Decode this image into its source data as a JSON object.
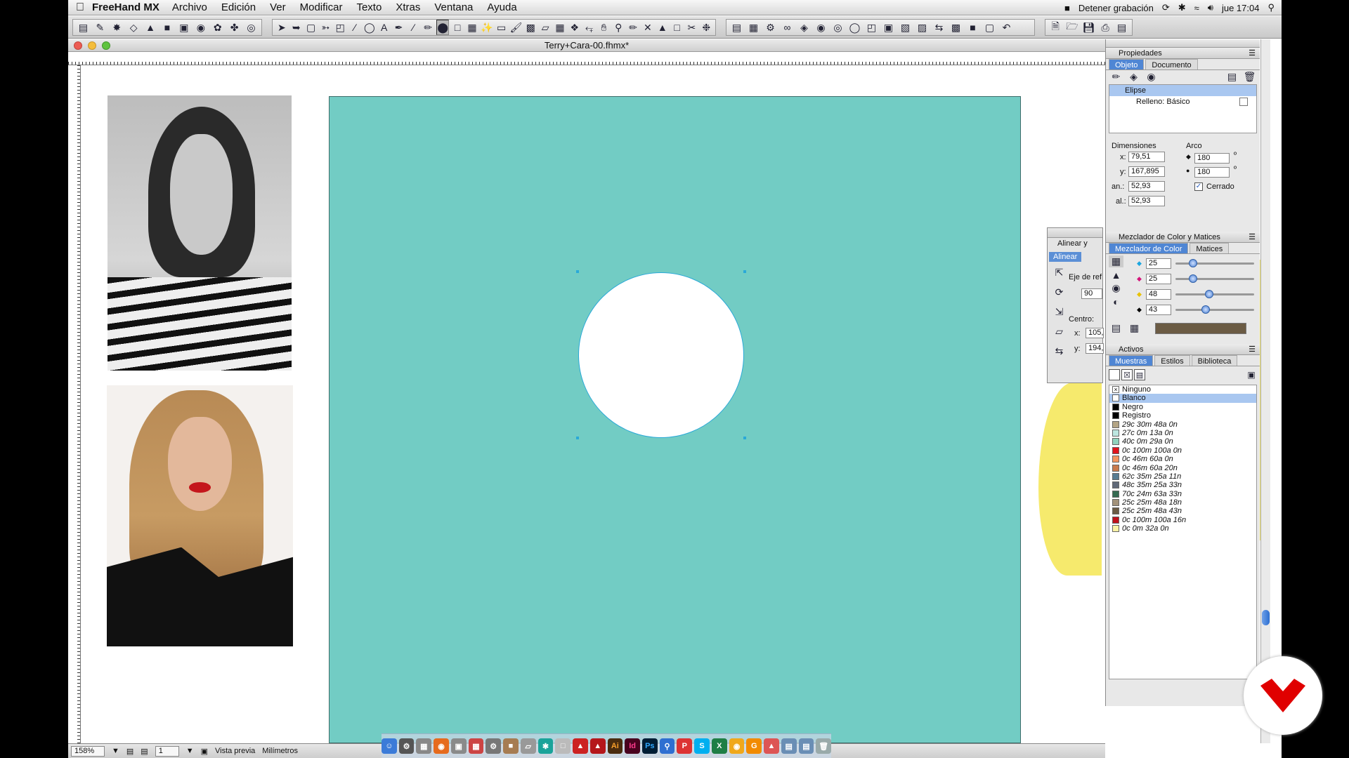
{
  "menubar": {
    "app_name": "FreeHand MX",
    "items": [
      "Archivo",
      "Edición",
      "Ver",
      "Modificar",
      "Texto",
      "Xtras",
      "Ventana",
      "Ayuda"
    ],
    "recording": "Detener grabación",
    "clock": "jue 17:04"
  },
  "document": {
    "title": "Terry+Cara-00.fhmx*"
  },
  "colors": {
    "artboard": "#72ccc4",
    "ellipse_fill": "#ffffff",
    "selection": "#2aa9d8"
  },
  "alinear_panel": {
    "title": "Alinear y",
    "tab": "Alinear",
    "eje_label": "Eje de ref",
    "eje_value": "90",
    "centro_label": "Centro:",
    "x_label": "x:",
    "x_value": "105,",
    "y_label": "y:",
    "y_value": "194,"
  },
  "properties": {
    "panel_title": "Propiedades",
    "tabs": [
      "Objeto",
      "Documento"
    ],
    "object_type": "Elipse",
    "fill": "Relleno: Básico",
    "dimensions_label": "Dimensiones",
    "x_label": "x:",
    "x": "79,51",
    "y_label": "y:",
    "y": "167,895",
    "w_label": "an.:",
    "w": "52,93",
    "h_label": "al.:",
    "h": "52,93",
    "arc_label": "Arco",
    "arc1": "180",
    "arc2": "180",
    "degree": "º",
    "closed_label": "Cerrado"
  },
  "mixer": {
    "panel_title": "Mezclador de Color y Matices",
    "tabs": [
      "Mezclador de Color",
      "Matices"
    ],
    "values": [
      "25",
      "25",
      "48",
      "43"
    ],
    "levels": [
      0.25,
      0.25,
      0.48,
      0.43
    ],
    "preview_color": "#6b5b44"
  },
  "assets": {
    "panel_title": "Activos",
    "tabs": [
      "Muestras",
      "Estilos",
      "Biblioteca"
    ],
    "swatches": [
      {
        "name": "Ninguno",
        "color": "#ffffff"
      },
      {
        "name": "Blanco",
        "color": "#ffffff"
      },
      {
        "name": "Negro",
        "color": "#000000"
      },
      {
        "name": "Registro",
        "color": "#000000"
      },
      {
        "name": "29c 30m 48a 0n",
        "color": "#b4a585"
      },
      {
        "name": "27c 0m 13a 0n",
        "color": "#bce6e0"
      },
      {
        "name": "40c 0m 29a 0n",
        "color": "#8fd3bd"
      },
      {
        "name": "0c 100m 100a 0n",
        "color": "#e0141c"
      },
      {
        "name": "0c 46m 60a 0n",
        "color": "#f3955f"
      },
      {
        "name": "0c 46m 60a 20n",
        "color": "#c97a4d"
      },
      {
        "name": "62c 35m 25a 11n",
        "color": "#587c91"
      },
      {
        "name": "48c 35m 25a 33n",
        "color": "#5f6877"
      },
      {
        "name": "70c 24m 63a 33n",
        "color": "#356b52"
      },
      {
        "name": "25c 25m 48a 18n",
        "color": "#a2927a"
      },
      {
        "name": "25c 25m 48a 43n",
        "color": "#6b5b44"
      },
      {
        "name": "0c 100m 100a 16n",
        "color": "#c0111b"
      },
      {
        "name": "0c 0m 32a 0n",
        "color": "#fbf2a4"
      }
    ]
  },
  "status": {
    "zoom": "158%",
    "page": "1",
    "view": "Vista previa",
    "units": "Milímetros"
  }
}
